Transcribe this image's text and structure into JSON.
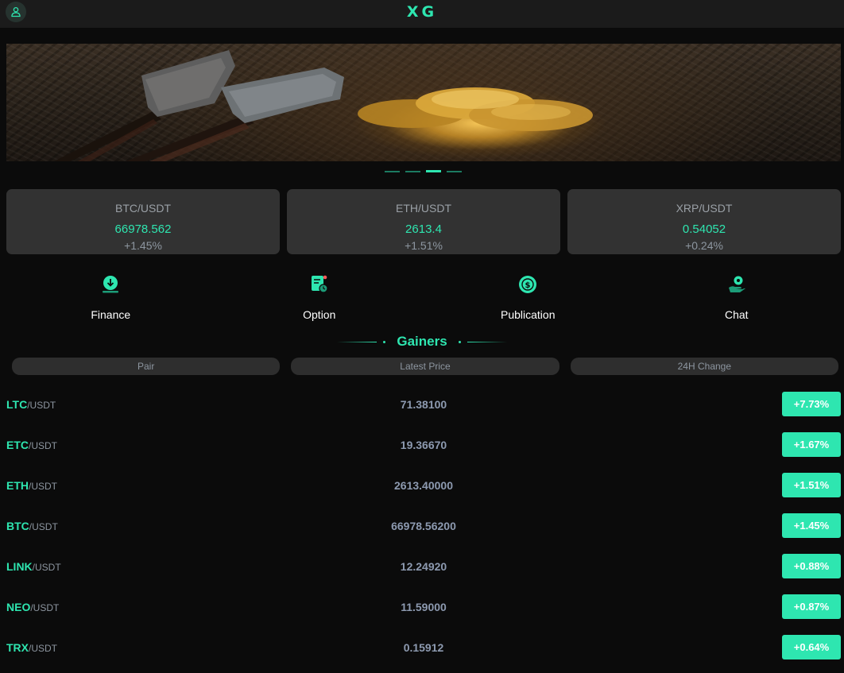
{
  "header": {
    "brand": "XG",
    "user_icon": "user-icon"
  },
  "colors": {
    "accent": "#2ee6b0",
    "background": "#0b0b0b",
    "card": "#323232"
  },
  "carousel": {
    "slide_count": 4,
    "active_index": 2
  },
  "tickers": [
    {
      "pair": "BTC/USDT",
      "price": "66978.562",
      "change": "+1.45%"
    },
    {
      "pair": "ETH/USDT",
      "price": "2613.4",
      "change": "+1.51%"
    },
    {
      "pair": "XRP/USDT",
      "price": "0.54052",
      "change": "+0.24%"
    }
  ],
  "menu": [
    {
      "label": "Finance",
      "icon": "finance-download-icon"
    },
    {
      "label": "Option",
      "icon": "option-document-icon"
    },
    {
      "label": "Publication",
      "icon": "publication-coin-icon"
    },
    {
      "label": "Chat",
      "icon": "chat-hand-icon"
    }
  ],
  "gainers": {
    "title": "Gainers",
    "columns": [
      "Pair",
      "Latest Price",
      "24H Change"
    ],
    "rows": [
      {
        "base": "LTC",
        "quote": "/USDT",
        "price": "71.38100",
        "change": "+7.73%"
      },
      {
        "base": "ETC",
        "quote": "/USDT",
        "price": "19.36670",
        "change": "+1.67%"
      },
      {
        "base": "ETH",
        "quote": "/USDT",
        "price": "2613.40000",
        "change": "+1.51%"
      },
      {
        "base": "BTC",
        "quote": "/USDT",
        "price": "66978.56200",
        "change": "+1.45%"
      },
      {
        "base": "LINK",
        "quote": "/USDT",
        "price": "12.24920",
        "change": "+0.88%"
      },
      {
        "base": "NEO",
        "quote": "/USDT",
        "price": "11.59000",
        "change": "+0.87%"
      },
      {
        "base": "TRX",
        "quote": "/USDT",
        "price": "0.15912",
        "change": "+0.64%"
      }
    ]
  }
}
